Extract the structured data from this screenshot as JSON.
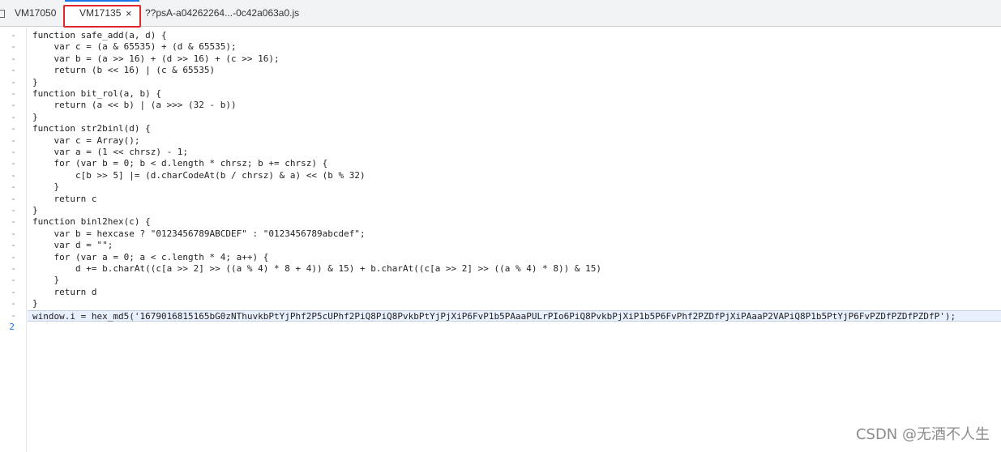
{
  "tabs": [
    {
      "label": "VM17050"
    },
    {
      "label": "VM17135",
      "active": true,
      "close": "×"
    },
    {
      "label": "??psA-a04262264...-0c42a063a0.js"
    }
  ],
  "gutter": {
    "fold_marker": "-",
    "last_line_number": "2"
  },
  "code_lines": [
    "function safe_add(a, d) {",
    "    var c = (a & 65535) + (d & 65535);",
    "    var b = (a >> 16) + (d >> 16) + (c >> 16);",
    "    return (b << 16) | (c & 65535)",
    "}",
    "function bit_rol(a, b) {",
    "    return (a << b) | (a >>> (32 - b))",
    "}",
    "function str2binl(d) {",
    "    var c = Array();",
    "    var a = (1 << chrsz) - 1;",
    "    for (var b = 0; b < d.length * chrsz; b += chrsz) {",
    "        c[b >> 5] |= (d.charCodeAt(b / chrsz) & a) << (b % 32)",
    "    }",
    "    return c",
    "}",
    "function binl2hex(c) {",
    "    var b = hexcase ? \"0123456789ABCDEF\" : \"0123456789abcdef\";",
    "    var d = \"\";",
    "    for (var a = 0; a < c.length * 4; a++) {",
    "        d += b.charAt((c[a >> 2] >> ((a % 4) * 8 + 4)) & 15) + b.charAt((c[a >> 2] >> ((a % 4) * 8)) & 15)",
    "    }",
    "    return d",
    "}",
    "window.i = hex_md5('1679016815165bG0zNThuvkbPtYjPhf2P5cUPhf2PiQ8PiQ8PvkbPtYjPjXiP6FvP1b5PAaaPULrPIo6PiQ8PvkbPjXiP1b5P6FvPhf2PZDfPjXiPAaaP2VAPiQ8P1b5PtYjP6FvPZDfPZDfPZDfP');"
  ],
  "watermark": "CSDN @无酒不人生"
}
